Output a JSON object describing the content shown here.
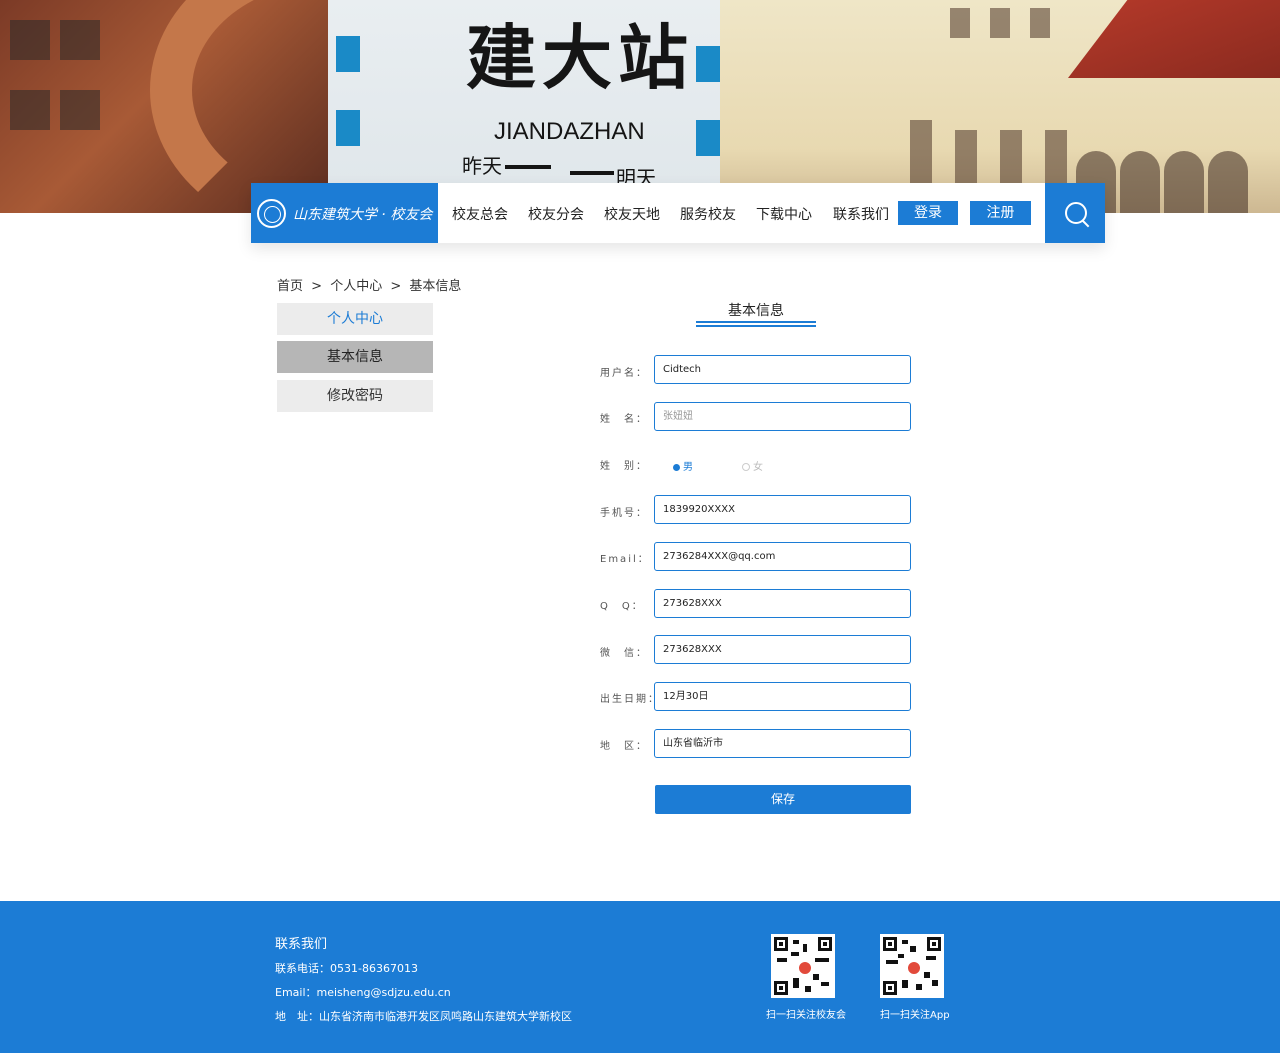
{
  "banner": {
    "sign_title": "建大站",
    "sign_pinyin": "JIANDAZHAN",
    "sign_left": "昨天",
    "sign_right": "明天"
  },
  "nav": {
    "logo_text": "山东建筑大学 · 校友会",
    "items": [
      "校友总会",
      "校友分会",
      "校友天地",
      "服务校友",
      "下载中心",
      "联系我们"
    ],
    "login": "登录",
    "register": "注册"
  },
  "breadcrumb": {
    "home": "首页",
    "sep": ">",
    "level1": "个人中心",
    "level2": "基本信息"
  },
  "sidebar": {
    "items": [
      "个人中心",
      "基本信息",
      "修改密码"
    ]
  },
  "form": {
    "title": "基本信息",
    "labels": {
      "username": "用户名：",
      "name": "姓　名：",
      "gender": "姓　别：",
      "phone": "手机号：",
      "email": "Email：",
      "qq": "Q　Q：",
      "wechat": "微　信：",
      "birthday": "出生日期：",
      "region": "地　区："
    },
    "values": {
      "username": "Cidtech",
      "name": "张妞妞",
      "phone": "1839920XXXX",
      "email": "2736284XXX@qq.com",
      "qq": "273628XXX",
      "wechat": "273628XXX",
      "birthday": "12月30日",
      "region": "山东省临沂市"
    },
    "gender_options": [
      "男",
      "女"
    ],
    "gender_selected": "男",
    "save": "保存"
  },
  "footer": {
    "title": "联系我们",
    "phone": "联系电话：0531-86367013",
    "email": "Email：meisheng@sdjzu.edu.cn",
    "address": "地　址：山东省济南市临港开发区凤鸣路山东建筑大学新校区",
    "qr1_caption": "扫一扫关注校友会",
    "qr2_caption": "扫一扫关注App"
  },
  "colors": {
    "primary": "#1c7cd5",
    "sidebar_active": "#b6b6b6",
    "sidebar_bg": "#ececec"
  }
}
